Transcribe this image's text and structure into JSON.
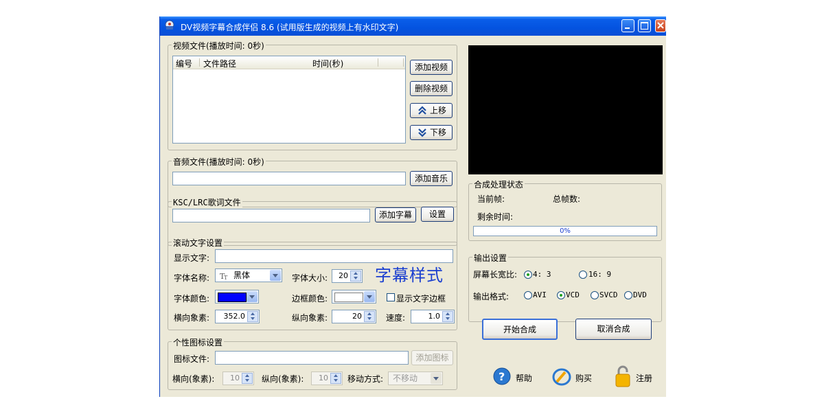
{
  "window": {
    "title": "DV视频字幕合成伴侣 8.6 (试用版生成的视频上有水印文字)"
  },
  "video_group": {
    "legend": "视频文件(播放时间: 0秒)",
    "columns": [
      "编号",
      "文件路径",
      "时间(秒)"
    ],
    "buttons": {
      "add": "添加视频",
      "delete": "删除视频",
      "up": "上移",
      "down": "下移"
    }
  },
  "audio_group": {
    "legend": "音频文件(播放时间: 0秒)",
    "path_value": "",
    "add_button": "添加音乐"
  },
  "lyrics_group": {
    "legend": "KSC/LRC歌词文件",
    "path_value": "",
    "add_button": "添加字幕",
    "settings_button": "设置"
  },
  "scroll_group": {
    "legend": "滚动文字设置",
    "display_text_label": "显示文字:",
    "display_text_value": "",
    "font_name_label": "字体名称:",
    "font_name_value": "黑体",
    "font_size_label": "字体大小:",
    "font_size_value": "20",
    "style_preview": "字幕样式",
    "font_color_label": "字体颜色:",
    "font_color": "#0000ff",
    "border_color_label": "边框颜色:",
    "border_color": "#ffffff",
    "show_border_label": "显示文字边框",
    "show_border_checked": false,
    "x_label": "横向象素:",
    "x_value": "352.0",
    "y_label": "纵向象素:",
    "y_value": "20",
    "speed_label": "速度:",
    "speed_value": "1.0"
  },
  "icon_group": {
    "legend": "个性图标设置",
    "file_label": "图标文件:",
    "file_value": "",
    "add_button": "添加图标",
    "x_label": "横向(象素):",
    "x_value": "10",
    "y_label": "纵向(象素):",
    "y_value": "10",
    "move_label": "移动方式:",
    "move_value": "不移动"
  },
  "status_group": {
    "legend": "合成处理状态",
    "current_frame_label": "当前帧:",
    "total_frames_label": "总帧数:",
    "remaining_label": "剩余时间:",
    "progress": 0,
    "progress_text": "0%"
  },
  "output_group": {
    "legend": "输出设置",
    "aspect_label": "屏幕长宽比:",
    "aspect_options": [
      "4: 3",
      "16: 9"
    ],
    "aspect_selected": "4: 3",
    "format_label": "输出格式:",
    "format_options": [
      "AVI",
      "VCD",
      "SVCD",
      "DVD"
    ],
    "format_selected": "VCD"
  },
  "actions": {
    "start": "开始合成",
    "cancel": "取消合成",
    "help": "帮助",
    "buy": "购买",
    "register": "注册"
  },
  "colors": {
    "titlebar": "#0453e0",
    "panel_bg": "#ece9d8",
    "preview_bg": "#000000",
    "style_text": "#1a3fd0"
  }
}
